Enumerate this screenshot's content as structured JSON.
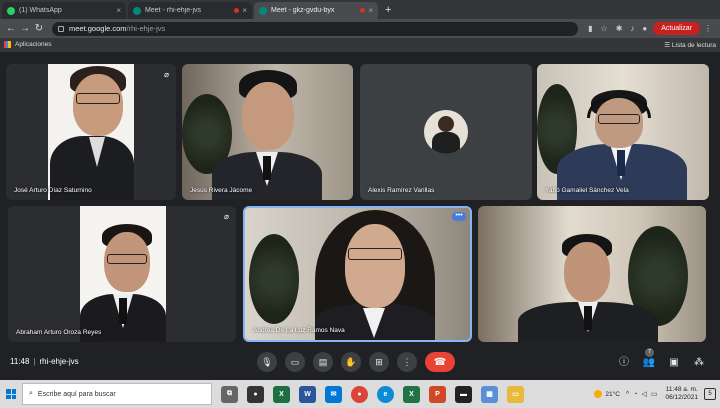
{
  "browser": {
    "tabs": [
      {
        "label": "(1) WhatsApp",
        "icon": "whatsapp-icon",
        "color": "#25d366",
        "active": false
      },
      {
        "label": "Meet - rhi-ehje-jvs",
        "icon": "meet-icon",
        "color": "#00897b",
        "active": false
      },
      {
        "label": "Meet - gkz-gvdu-byx",
        "icon": "meet-icon",
        "color": "#00897b",
        "active": true
      }
    ],
    "url_host": "meet.google.com",
    "url_path": "/rhi-ehje-jvs",
    "update_label": "Actualizar",
    "bookmarks_apps_label": "Aplicaciones",
    "reading_list_label": "Lista de lectura"
  },
  "participants": [
    {
      "name": "José Arturo Díaz Saturnino",
      "muted": true
    },
    {
      "name": "Jesús Rivera Jácome",
      "muted": false
    },
    {
      "name": "Alexis Ramírez Varillas",
      "muted": false
    },
    {
      "name": "Yaftó Gamaliel Sánchez Vela",
      "muted": false
    },
    {
      "name": "Abraham Arturo Oroza Reyes",
      "muted": true
    },
    {
      "name": "Andrea De La Luz Ramos Nava",
      "muted": false
    },
    {
      "name": "",
      "muted": false
    }
  ],
  "meeting": {
    "time": "11:48",
    "code": "rhi-ehje-jvs",
    "participant_count": "7"
  },
  "taskbar": {
    "search_placeholder": "Escribe aquí para buscar",
    "temperature": "21°C",
    "time": "11:48 a. m.",
    "date": "06/12/2021",
    "notification_count": "5"
  }
}
